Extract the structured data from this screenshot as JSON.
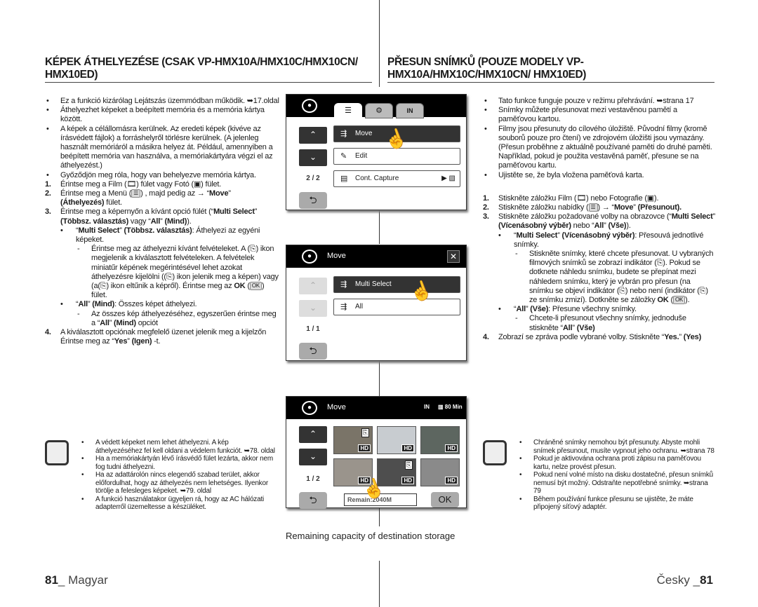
{
  "left": {
    "heading": "KÉPEK ÁTHELYEZÉSE (CSAK VP-HMX10A/HMX10C/HMX10CN/ HMX10ED)",
    "bullets": [
      "Ez a funkció kizárólag Lejátszás üzemmódban működik. ➥17.oldal",
      "Áthelyezhet képeket a beépített memória és a memória kártya között.",
      "A képek a célállomásra kerülnek. Az eredeti képek (kivéve az írásvédett fájlok) a forráshelyről törlésre kerülnek. (A jelenleg használt memóriáról a másikra helyez át. Például, amennyiben a beépített memória van használva, a memóriakártyára végzi el az áthelyezést.)",
      "Győződjön meg róla, hogy van behelyezve memória kártya."
    ],
    "steps": {
      "s1": "Érintse meg a Film (🎞) fület vagy Fotó (▣) fület.",
      "s2a": "Érintse meg a Menü (",
      "s2b": ") , majd pedig az → “",
      "s2move": "Move",
      "s2c": "” ",
      "s2bold": "(Áthelyezés)",
      "s2d": " fület.",
      "s3a": "Érintse meg a képernyőn a kívánt opció fülét (“",
      "s3b1": "Multi Select",
      "s3c": "” ",
      "s3b2": "(Többsz. választás)",
      "s3d": " vagy “",
      "s3b3": "All",
      "s3e": "” ",
      "s3b4": "(Mind)",
      "s3f": ").",
      "ms_a": "“",
      "ms_b": "Multi Select",
      "ms_c": "” ",
      "ms_d": "(Többsz. választás)",
      "ms_e": ": Áthelyezi az egyéni képeket.",
      "ms_detail": "Érintse meg az áthelyezni kívánt felvételeket. A (⎘) ikon megjelenik a kiválasztott felvételeken. A felvételek miniatűr képének megérintésével lehet azokat áthelyezésre kijelölni ((⎘) ikon jelenik meg a képen) vagy (a(⎘) ikon eltűnik a képről). Érintse meg az ",
      "ok_bold": "OK",
      "ok_tail": " fület.",
      "all_a": "“",
      "all_b": "All",
      "all_c": "” ",
      "all_d": "(Mind)",
      "all_e": ": Összes képet áthelyezi.",
      "all_detail_a": "Az összes kép áthelyezéséhez, egyszerűen érintse meg a “",
      "all_detail_b": "All",
      "all_detail_c": "” ",
      "all_detail_d": "(Mind)",
      "all_detail_e": " opciót",
      "s4a": "A kiválasztott opciónak megfelelő üzenet jelenik meg a kijelzőn Érintse  meg az “",
      "s4b": "Yes",
      "s4c": "” ",
      "s4d": "(Igen)",
      "s4e": " -t."
    },
    "notes": [
      "A védett képeket nem lehet áthelyezni. A kép áthelyezéséhez fel kell oldani a védelem funkciót. ➥78. oldal",
      "Ha a memóriakártyán lévő írásvédő fület lezárta, akkor nem fog tudni áthelyezni.",
      "Ha az adattárolón nincs elegendő szabad terület, akkor előfordulhat, hogy az áthelyezés nem lehetséges. Ilyenkor törölje a felesleges képeket. ➥79. oldal",
      "A funkció használatakor ügyeljen rá, hogy az AC hálózati adapterről üzemeltesse a készüléket."
    ]
  },
  "right": {
    "heading": "PŘESUN SNÍMKŮ (POUZE MODELY VP-HMX10A/HMX10C/HMX10CN/ HMX10ED)",
    "bullets": [
      "Tato funkce funguje pouze v režimu přehrávání. ➥strana 17",
      "Snímky můžete přesunovat mezi vestavěnou pamětí a paměťovou kartou.",
      "Filmy jsou přesunuty do cílového úložiště. Původní filmy (kromě souborů pouze pro čtení) ve zdrojovém úložišti jsou vymazány. (Přesun proběhne z aktuálně používané paměti do druhé paměti. Například, pokud je použita vestavěná paměť, přesune se na paměťovou kartu.",
      "Ujistěte se, že byla vložena paměťová karta."
    ],
    "steps": {
      "s1": "Stiskněte záložku Film (🎞) nebo Fotografie (▣).",
      "s2a": "Stiskněte záložku nabídky (",
      "s2b": ") → “",
      "s2move": "Move",
      "s2c": "” ",
      "s2bold": "(Přesunout).",
      "s3a": "Stiskněte záložku požadované volby na obrazovce (“",
      "s3b1": "Multi Select",
      "s3c": "” ",
      "s3b2": "(Vícenásobný výběr)",
      "s3d": " nebo “",
      "s3b3": "All",
      "s3e": "” ",
      "s3b4": "(Vše)",
      "s3f": ").",
      "ms_a": "“",
      "ms_b": "Multi Select",
      "ms_c": "” ",
      "ms_d": "(Vícenásobný výběr)",
      "ms_e": ": Přesouvá jednotlivé snímky.",
      "ms_detail": "Stiskněte snímky, které chcete přesunovat. U vybraných filmových snímků se zobrazí indikátor (⎘). Pokud se dotknete náhledu snímku, budete se přepínat mezi náhledem snímku, který je vybrán pro přesun (na snímku se objeví indikátor (⎘) nebo není (indikátor (⎘) ze snímku zmizí). Dotkněte se záložky ",
      "ok_bold": "OK",
      "ok_tail": ".",
      "all_a": "“",
      "all_b": "All",
      "all_c": "” ",
      "all_d": "(Vše)",
      "all_e": ": Přesune všechny snímky.",
      "all_detail_a": "Chcete-li přesunout všechny snímky, jednoduše stiskněte “",
      "all_detail_b": "All",
      "all_detail_c": "” ",
      "all_detail_d": "(Vše)",
      "all_detail_e": "",
      "s4a": "Zobrazí se zpráva podle vybrané volby. Stiskněte “",
      "s4b": "Yes.",
      "s4c": "” ",
      "s4d": "(Yes)",
      "s4e": ""
    },
    "notes": [
      "Chráněné snímky nemohou být přesunuty. Abyste mohli snímek přesunout, musíte vypnout jeho ochranu. ➥strana 78",
      "Pokud je aktivována ochrana proti zápisu na paměťovou kartu, nelze provést přesun.",
      "Pokud není volné místo na disku dostatečné, přesun snímků nemusí být možný. Odstraňte nepotřebné snímky. ➥strana 79",
      "Během používání funkce přesunu se ujistěte, že máte připojený síťový adaptér."
    ]
  },
  "icons": {
    "ok_mini": "OK",
    "menu_mini": "☰",
    "bullet": "•",
    "dash": "-"
  },
  "screen1": {
    "tabs": [
      "☰",
      "⚙",
      "IN"
    ],
    "items": [
      {
        "icon": "⇶",
        "label": "Move"
      },
      {
        "icon": "✎",
        "label": "Edit"
      },
      {
        "icon": "▤",
        "label": "Cont. Capture",
        "value": "▶ ▧"
      }
    ],
    "page": "2 / 2",
    "up": "⌃",
    "down": "⌄",
    "back": "⮌"
  },
  "screen2": {
    "title": "Move",
    "close": "✕",
    "items": [
      {
        "icon": "⇶",
        "label": "Multi Select"
      },
      {
        "icon": "⇶",
        "label": "All"
      }
    ],
    "page": "1 / 1",
    "up": "⌃",
    "down": "⌄",
    "back": "⮌"
  },
  "screen3": {
    "title": "Move",
    "storage": "IN",
    "battery": "▥ 80 Min",
    "page": "1 / 2",
    "up": "⌃",
    "down": "⌄",
    "back": "⮌",
    "thumb_badge": "HD",
    "selected_badge": "⎘",
    "remain": "Remain:2040M",
    "ok": "OK",
    "thumbs": [
      {
        "selected": true,
        "color": "#7a7468"
      },
      {
        "selected": false,
        "color": "#c8ccd0"
      },
      {
        "selected": false,
        "color": "#5d6660"
      },
      {
        "selected": false,
        "color": "#9a948c"
      },
      {
        "selected": true,
        "color": "#4e4e4e"
      },
      {
        "selected": false,
        "color": "#8a8a8a"
      }
    ]
  },
  "caption": "Remaining capacity of destination storage",
  "footer": {
    "left_num": "81",
    "left_lang": "_ Magyar",
    "right_lang": "Česky _",
    "right_num": "81"
  }
}
